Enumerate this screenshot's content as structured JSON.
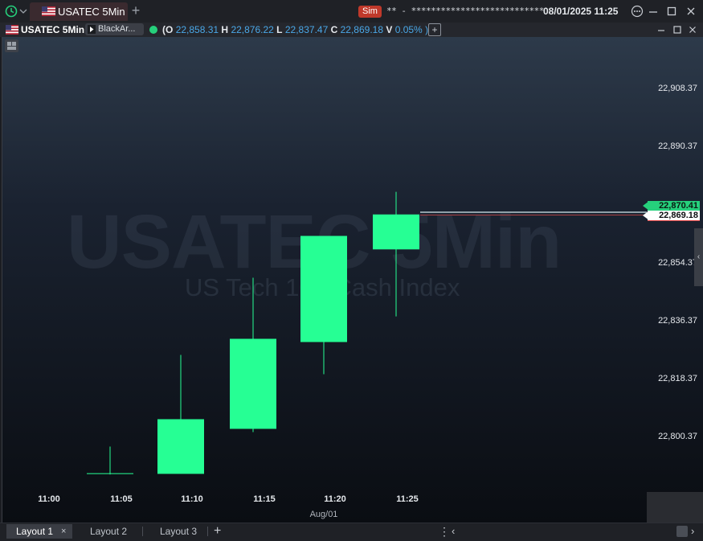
{
  "titlebar": {
    "tab_label": "USATEC 5Min",
    "new_tab": "+",
    "sim_badge": "Sim",
    "account": "** - ***************************",
    "datetime": "08/01/2025 11:25"
  },
  "chart_header": {
    "instrument": "USATEC 5Min",
    "account_chip": "BlackAr...",
    "ohlc": {
      "open_key": "(O",
      "open": "22,858.31",
      "high_key": "H",
      "high": "22,876.22",
      "low_key": "L",
      "low": "22,837.47",
      "close_key": "C",
      "close": "22,869.18",
      "volume_key": "V",
      "change": "0.05% )"
    },
    "add_indicator": "+"
  },
  "watermark": {
    "symbol": "USATEC 5Min",
    "description": "US Tech 100 Cash Index"
  },
  "price_tags": {
    "high_tag": "22,870.41",
    "last_tag": "22,869.18"
  },
  "colors": {
    "bull_candle": "#26ff94",
    "accent_green": "#26d07c",
    "sim_red": "#c0392b",
    "ohlc_value": "#4aa8e8"
  },
  "chart_data": {
    "type": "candlestick",
    "title": "USATEC 5Min",
    "x_date_label": "Aug/01",
    "y_tick_labels": [
      "22,908.37",
      "22,890.37",
      "22,872.37",
      "22,854.37",
      "22,836.37",
      "22,818.37",
      "22,800.37"
    ],
    "y_ticks": [
      22908.37,
      22890.37,
      22872.37,
      22854.37,
      22836.37,
      22818.37,
      22800.37
    ],
    "ylim": [
      22783.5,
      22935.5
    ],
    "x_tick_labels": [
      "11:00",
      "11:05",
      "11:10",
      "11:15",
      "11:20",
      "11:25"
    ],
    "candles": [
      {
        "time": "11:05",
        "open": 22788.5,
        "high": 22797.0,
        "low": 22788.3,
        "close": 22788.7
      },
      {
        "time": "11:10",
        "open": 22788.5,
        "high": 22825.5,
        "low": 22788.5,
        "close": 22805.5
      },
      {
        "time": "11:15",
        "open": 22802.5,
        "high": 22849.5,
        "low": 22801.5,
        "close": 22830.5
      },
      {
        "time": "11:20",
        "open": 22829.5,
        "high": 22862.5,
        "low": 22819.5,
        "close": 22862.5
      },
      {
        "time": "11:25",
        "open": 22858.31,
        "high": 22876.22,
        "low": 22837.47,
        "close": 22869.18
      }
    ],
    "grid": false
  },
  "bottombar": {
    "layouts": [
      "Layout 1",
      "Layout 2",
      "Layout 3"
    ],
    "close": "×",
    "add": "+"
  },
  "icons": {
    "menu": "⋮",
    "left": "‹",
    "right": "›"
  }
}
